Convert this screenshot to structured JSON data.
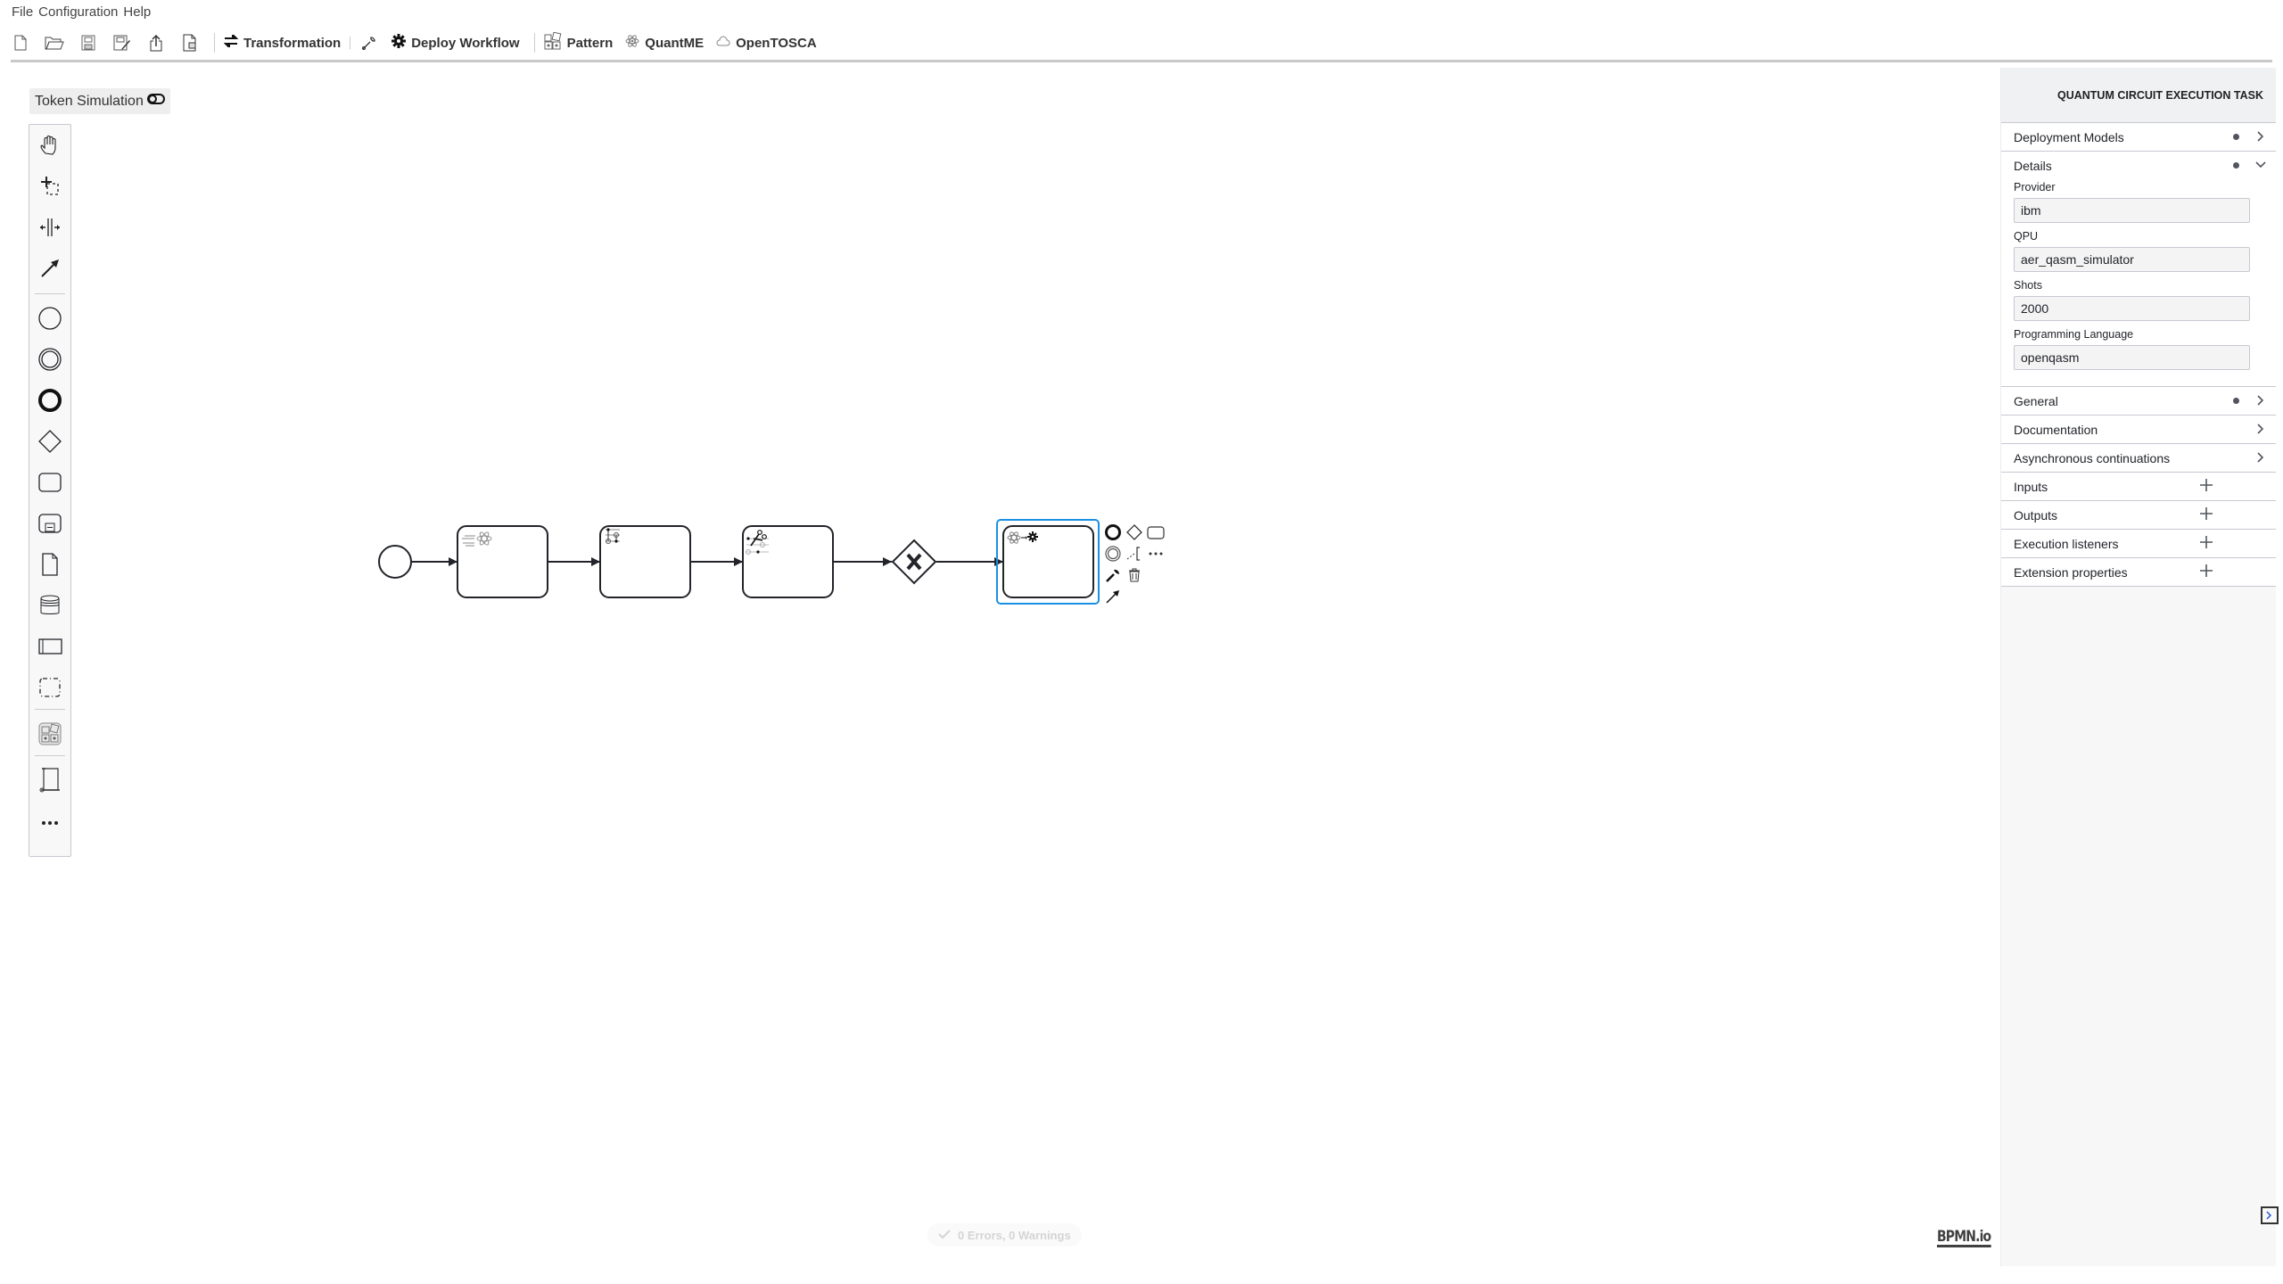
{
  "menu": {
    "items": [
      "File",
      "Configuration",
      "Help"
    ]
  },
  "toolbar": {
    "file_icons": [
      "new-file-icon",
      "open-folder-icon",
      "save-icon",
      "save-as-icon",
      "upload-icon",
      "export-file-icon"
    ],
    "transformation_label": "Transformation",
    "deploy_label": "Deploy Workflow",
    "pattern_label": "Pattern",
    "quantme_label": "QuantME",
    "opentosca_label": "OpenTOSCA"
  },
  "token_simulation": {
    "label": "Token Simulation"
  },
  "palette": {
    "tools": [
      "hand-tool",
      "lasso-tool",
      "space-tool",
      "global-connect-tool"
    ],
    "elements": [
      "start-event",
      "intermediate-event",
      "end-event",
      "gateway",
      "task",
      "subprocess",
      "data-object",
      "data-store",
      "pool",
      "group"
    ],
    "extras": [
      "pattern-selection",
      "quantme-data-map",
      "more"
    ]
  },
  "diagram": {
    "elements": [
      {
        "type": "startEvent"
      },
      {
        "type": "task",
        "icon": "quantum-data-preparation"
      },
      {
        "type": "task",
        "icon": "quantum-circuit-loading"
      },
      {
        "type": "task",
        "icon": "circuit-cutting"
      },
      {
        "type": "exclusiveGateway",
        "marker": "X"
      },
      {
        "type": "task",
        "icon": "quantum-circuit-execution",
        "selected": true
      }
    ],
    "selection_color": "#1a8fe3"
  },
  "lint": {
    "text": "0 Errors, 0 Warnings"
  },
  "logo": {
    "text": "BPMN.io"
  },
  "properties": {
    "title": "QUANTUM CIRCUIT EXECUTION TASK",
    "groups": [
      {
        "label": "Deployment Models",
        "has_dot": true,
        "state": "collapsed"
      },
      {
        "label": "Details",
        "has_dot": true,
        "state": "expanded",
        "fields": [
          {
            "label": "Provider",
            "value": "ibm"
          },
          {
            "label": "QPU",
            "value": "aer_qasm_simulator"
          },
          {
            "label": "Shots",
            "value": "2000"
          },
          {
            "label": "Programming Language",
            "value": "openqasm"
          }
        ]
      },
      {
        "label": "General",
        "has_dot": true,
        "state": "collapsed"
      },
      {
        "label": "Documentation",
        "has_dot": false,
        "state": "collapsed"
      },
      {
        "label": "Asynchronous continuations",
        "has_dot": false,
        "state": "collapsed"
      },
      {
        "label": "Inputs",
        "action": "add"
      },
      {
        "label": "Outputs",
        "action": "add"
      },
      {
        "label": "Execution listeners",
        "action": "add"
      },
      {
        "label": "Extension properties",
        "action": "add"
      }
    ]
  }
}
